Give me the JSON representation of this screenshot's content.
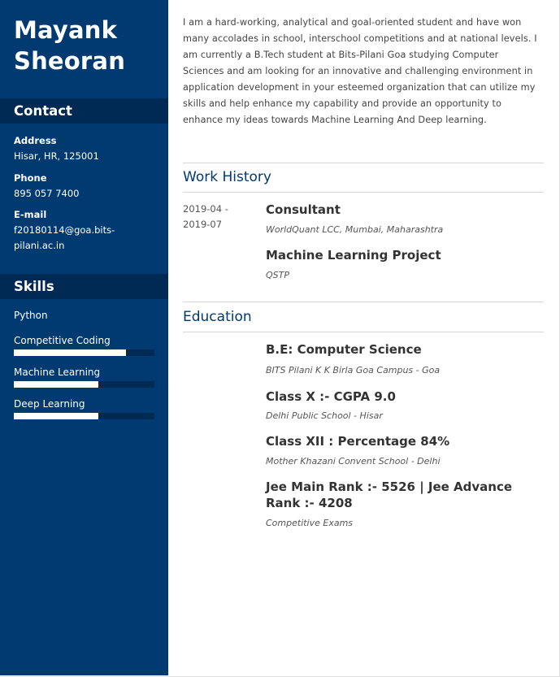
{
  "profile": {
    "first_name": "Mayank",
    "last_name": "Sheoran",
    "summary": "I am a hard-working, analytical and goal-oriented student and have won many accolades in school, interschool competitions and at national levels. I am currently a B.Tech student at Bits-Pilani Goa studying Computer Sciences and am looking for an innovative and challenging environment in application development in your esteemed organization that can utilize my skills and help enhance my capability and provide an opportunity to enhance my ideas towards Machine Learning And Deep learning."
  },
  "contact": {
    "heading": "Contact",
    "address_label": "Address",
    "address_value": "Hisar, HR, 125001",
    "phone_label": "Phone",
    "phone_value": "895 057 7400",
    "email_label": "E-mail",
    "email_line1": "f20180114@goa.bits-",
    "email_line2": "pilani.ac.in"
  },
  "skills": {
    "heading": "Skills",
    "items": [
      {
        "label": "Python"
      },
      {
        "label": "Competitive Coding",
        "level": 0.8
      },
      {
        "label": "Machine Learning",
        "level": 0.6
      },
      {
        "label": "Deep Learning",
        "level": 0.6
      }
    ]
  },
  "work_history": {
    "heading": "Work History",
    "date_start": "2019-04 -",
    "date_end": "2019-07",
    "entries": [
      {
        "title": "Consultant",
        "subtitle": "WorldQuant LCC, Mumbai, Maharashtra"
      },
      {
        "title": "Machine Learning Project",
        "subtitle": "QSTP"
      }
    ]
  },
  "education": {
    "heading": "Education",
    "entries": [
      {
        "title": "B.E: Computer Science",
        "subtitle": "BITS Pilani K K Birla Goa Campus - Goa"
      },
      {
        "title": "Class X :- CGPA 9.0",
        "subtitle": "Delhi Public School - Hisar"
      },
      {
        "title": "Class XII : Percentage 84%",
        "subtitle": "Mother Khazani Convent School - Delhi"
      },
      {
        "title": "Jee Main Rank :- 5526 | Jee Advance Rank :- 4208",
        "subtitle": "Competitive Exams"
      }
    ]
  },
  "colors": {
    "sidebar": "#003a70",
    "sidebar_header": "#002a53",
    "accent": "#003a70"
  }
}
